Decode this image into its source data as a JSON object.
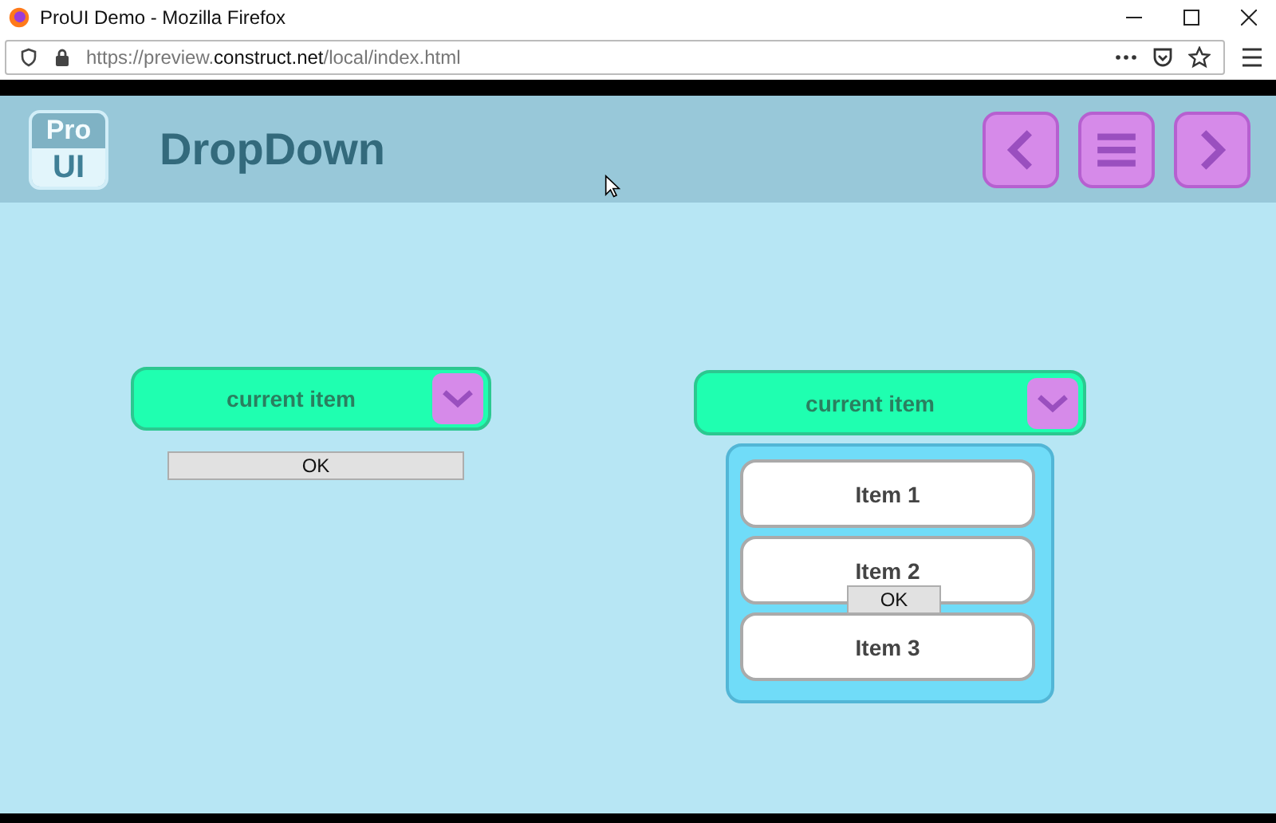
{
  "window": {
    "title": "ProUI Demo - Mozilla Firefox"
  },
  "address_bar": {
    "scheme": "https://preview.",
    "host": "construct.net",
    "path": "/local/index.html"
  },
  "header": {
    "logo": {
      "top": "Pro",
      "bottom": "UI"
    },
    "title": "DropDown"
  },
  "dropdowns": [
    {
      "value": "current item",
      "ok_button": "OK"
    },
    {
      "value": "current item",
      "ok_button": "OK",
      "items": [
        {
          "label": "Item 1"
        },
        {
          "label": "Item 2"
        },
        {
          "label": "Item 3"
        }
      ]
    }
  ]
}
